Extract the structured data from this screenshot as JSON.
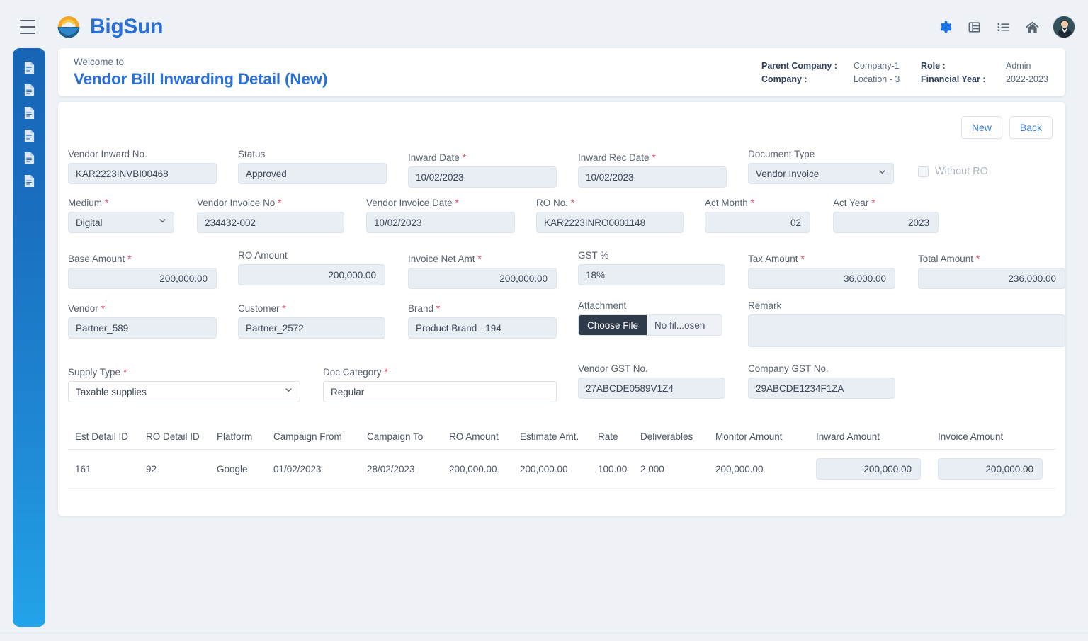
{
  "app": {
    "brand_name": "BigSun",
    "menu_icon": "hamburger-icon",
    "header_icons": [
      "gear-icon",
      "table-icon",
      "list-icon",
      "home-icon",
      "avatar"
    ]
  },
  "page_header": {
    "welcome": "Welcome to",
    "title": "Vendor Bill Inwarding Detail (New)",
    "meta": {
      "parent_company_label": "Parent Company :",
      "parent_company_value": "Company-1",
      "company_label": "Company :",
      "company_value": "Location - 3",
      "role_label": "Role :",
      "role_value": "Admin",
      "financial_year_label": "Financial Year :",
      "financial_year_value": "2022-2023"
    }
  },
  "actions": {
    "new_label": "New",
    "back_label": "Back"
  },
  "form": {
    "vendor_inward_no": {
      "label": "Vendor Inward No.",
      "value": "KAR2223INVBI00468",
      "required": false
    },
    "status": {
      "label": "Status",
      "value": "Approved",
      "required": false
    },
    "inward_date": {
      "label": "Inward Date",
      "value": "10/02/2023",
      "required": true
    },
    "inward_rec_date": {
      "label": "Inward Rec Date",
      "value": "10/02/2023",
      "required": true
    },
    "document_type": {
      "label": "Document Type",
      "value": "Vendor Invoice",
      "required": false
    },
    "without_ro": {
      "label": "Without RO",
      "checked": false
    },
    "medium": {
      "label": "Medium",
      "value": "Digital",
      "required": true
    },
    "vendor_invoice_no": {
      "label": "Vendor Invoice No",
      "value": "234432-002",
      "required": true
    },
    "vendor_invoice_date": {
      "label": "Vendor Invoice Date",
      "value": "10/02/2023",
      "required": true
    },
    "ro_no": {
      "label": "RO No.",
      "value": "KAR2223INRO0001148",
      "required": true
    },
    "act_month": {
      "label": "Act Month",
      "value": "02",
      "required": true
    },
    "act_year": {
      "label": "Act Year",
      "value": "2023",
      "required": true
    },
    "base_amount": {
      "label": "Base Amount",
      "value": "200,000.00",
      "required": true
    },
    "ro_amount": {
      "label": "RO Amount",
      "value": "200,000.00",
      "required": false
    },
    "invoice_net_amt": {
      "label": "Invoice Net Amt",
      "value": "200,000.00",
      "required": true
    },
    "gst_percent": {
      "label": "GST %",
      "value": "18%",
      "required": false
    },
    "tax_amount": {
      "label": "Tax Amount",
      "value": "36,000.00",
      "required": true
    },
    "total_amount": {
      "label": "Total Amount",
      "value": "236,000.00",
      "required": true
    },
    "vendor": {
      "label": "Vendor",
      "value": "Partner_589",
      "required": true
    },
    "customer": {
      "label": "Customer",
      "value": "Partner_2572",
      "required": true
    },
    "brand": {
      "label": "Brand",
      "value": "Product Brand - 194",
      "required": true
    },
    "attachment": {
      "label": "Attachment",
      "button_label": "Choose File",
      "file_name": "No fil...osen"
    },
    "remark": {
      "label": "Remark",
      "value": ""
    },
    "supply_type": {
      "label": "Supply Type",
      "value": "Taxable supplies",
      "required": true
    },
    "doc_category": {
      "label": "Doc Category",
      "value": "Regular",
      "required": true
    },
    "vendor_gst_no": {
      "label": "Vendor GST No.",
      "value": "27ABCDE0589V1Z4",
      "required": false
    },
    "company_gst_no": {
      "label": "Company GST No.",
      "value": "29ABCDE1234F1ZA",
      "required": false
    }
  },
  "table": {
    "columns": [
      "Est Detail ID",
      "RO Detail ID",
      "Platform",
      "Campaign From",
      "Campaign To",
      "RO Amount",
      "Estimate Amt.",
      "Rate",
      "Deliverables",
      "Monitor Amount",
      "Inward Amount",
      "Invoice Amount"
    ],
    "rows": [
      {
        "est_detail_id": "161",
        "ro_detail_id": "92",
        "platform": "Google",
        "campaign_from": "01/02/2023",
        "campaign_to": "28/02/2023",
        "ro_amount": "200,000.00",
        "estimate_amt": "200,000.00",
        "rate": "100.00",
        "deliverables": "2,000",
        "monitor_amount": "200,000.00",
        "inward_amount": "200,000.00",
        "invoice_amount": "200,000.00"
      }
    ]
  },
  "colors": {
    "brand_blue": "#2a70d8",
    "sidebar_top": "#1765b5",
    "sidebar_bottom": "#22a3ea",
    "required_red": "#e0506b",
    "page_bg": "#eef2f7",
    "input_bg": "#e9eef5"
  }
}
